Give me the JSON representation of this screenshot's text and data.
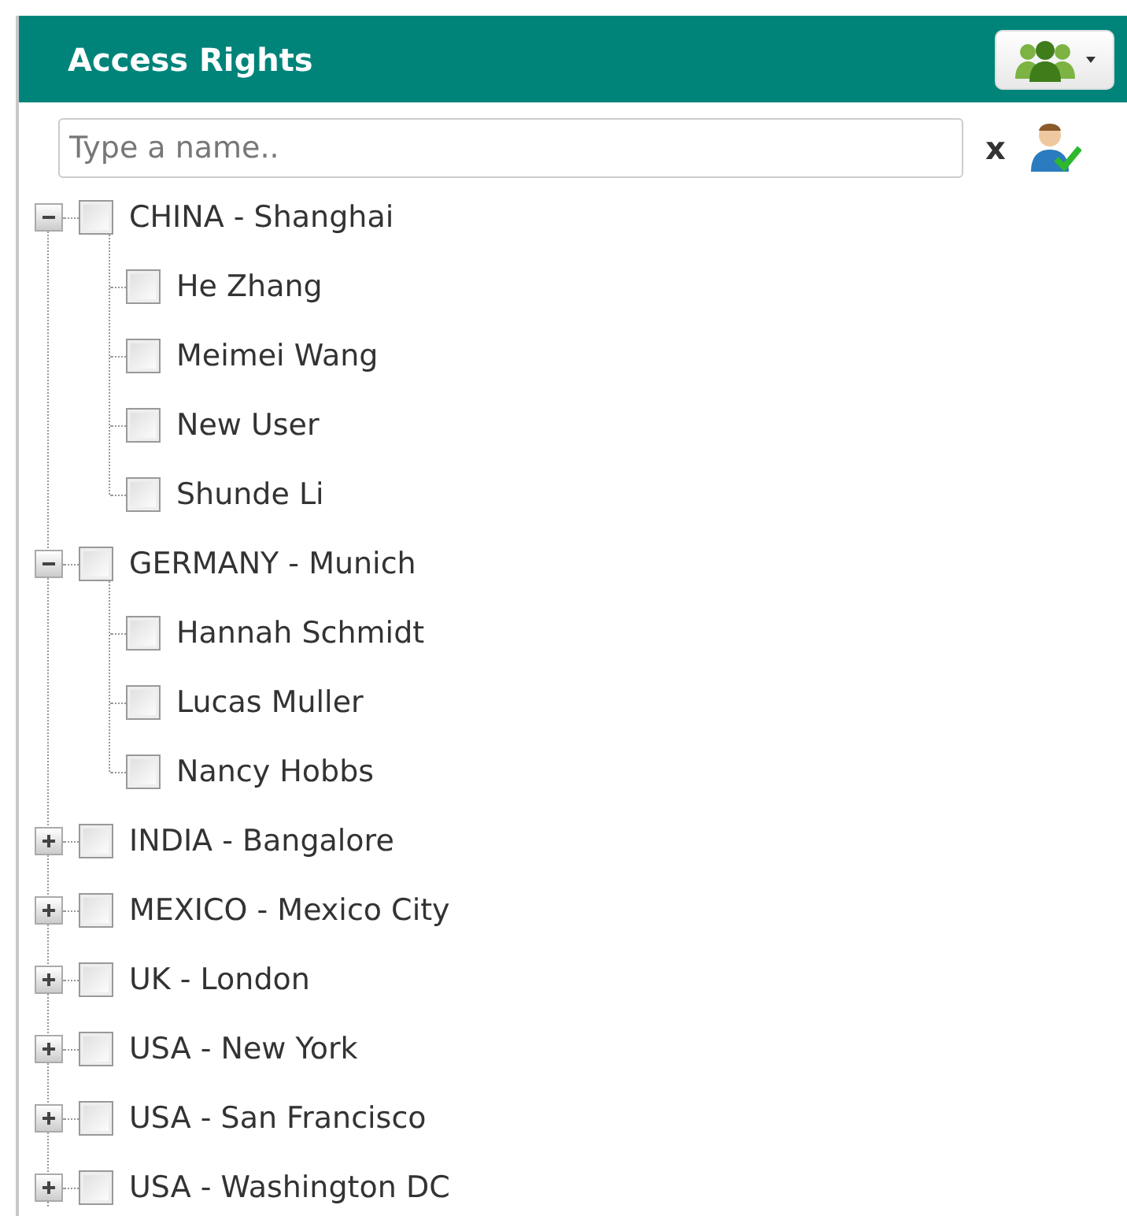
{
  "header": {
    "title": "Access Rights"
  },
  "search": {
    "placeholder": "Type a name.."
  },
  "clear_button": "x",
  "tree": [
    {
      "label": "CHINA - Shanghai",
      "expanded": true,
      "checked": false,
      "children": [
        {
          "label": "He Zhang",
          "checked": false
        },
        {
          "label": "Meimei Wang",
          "checked": false
        },
        {
          "label": "New User",
          "checked": false
        },
        {
          "label": "Shunde Li",
          "checked": false
        }
      ]
    },
    {
      "label": "GERMANY - Munich",
      "expanded": true,
      "checked": false,
      "children": [
        {
          "label": "Hannah Schmidt",
          "checked": false
        },
        {
          "label": "Lucas Muller",
          "checked": false
        },
        {
          "label": "Nancy Hobbs",
          "checked": false
        }
      ]
    },
    {
      "label": "INDIA - Bangalore",
      "expanded": false,
      "checked": false
    },
    {
      "label": "MEXICO - Mexico City",
      "expanded": false,
      "checked": false
    },
    {
      "label": "UK - London",
      "expanded": false,
      "checked": false
    },
    {
      "label": "USA - New York",
      "expanded": false,
      "checked": false
    },
    {
      "label": "USA - San Francisco",
      "expanded": false,
      "checked": false
    },
    {
      "label": "USA - Washington DC",
      "expanded": false,
      "checked": false
    }
  ]
}
